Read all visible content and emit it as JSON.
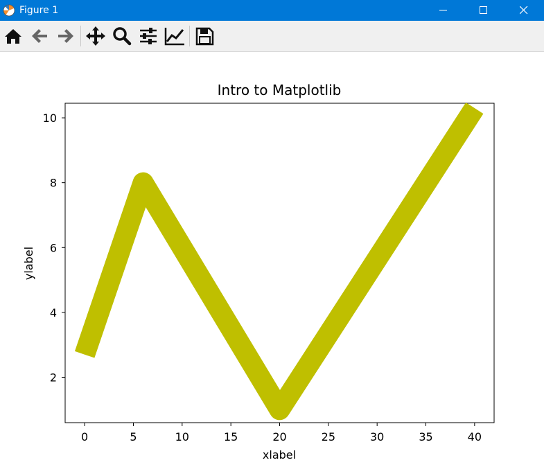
{
  "window": {
    "title": "Figure 1",
    "app_icon": "matplotlib-icon",
    "controls": [
      "minimize-icon",
      "maximize-icon",
      "close-icon"
    ],
    "titlebar_color": "#0078d7"
  },
  "toolbar": {
    "buttons": [
      {
        "icon": "home-icon",
        "tooltip": "Reset original view"
      },
      {
        "icon": "back-arrow-icon",
        "tooltip": "Back to previous view"
      },
      {
        "icon": "forward-arrow-icon",
        "tooltip": "Forward to next view"
      },
      {
        "icon": "pan-icon",
        "tooltip": "Pan axes"
      },
      {
        "icon": "zoom-icon",
        "tooltip": "Zoom to rectangle"
      },
      {
        "icon": "subplots-icon",
        "tooltip": "Configure subplots"
      },
      {
        "icon": "edit-axis-icon",
        "tooltip": "Edit axis, curve and image parameters"
      },
      {
        "icon": "save-icon",
        "tooltip": "Save the figure"
      }
    ]
  },
  "chart_data": {
    "type": "line",
    "title": "Intro to Matplotlib",
    "xlabel": "xlabel",
    "ylabel": "ylabel",
    "x": [
      0,
      6,
      20,
      40
    ],
    "series": [
      {
        "values": [
          2.7,
          8,
          1,
          10.3
        ],
        "color": "#bfbf00"
      }
    ],
    "xlim": [
      -2,
      42
    ],
    "ylim": [
      0.6,
      10.45
    ],
    "xticks": [
      "0",
      "5",
      "10",
      "15",
      "20",
      "25",
      "30",
      "35",
      "40"
    ],
    "yticks": [
      "2",
      "4",
      "6",
      "8",
      "10"
    ],
    "grid": false
  }
}
